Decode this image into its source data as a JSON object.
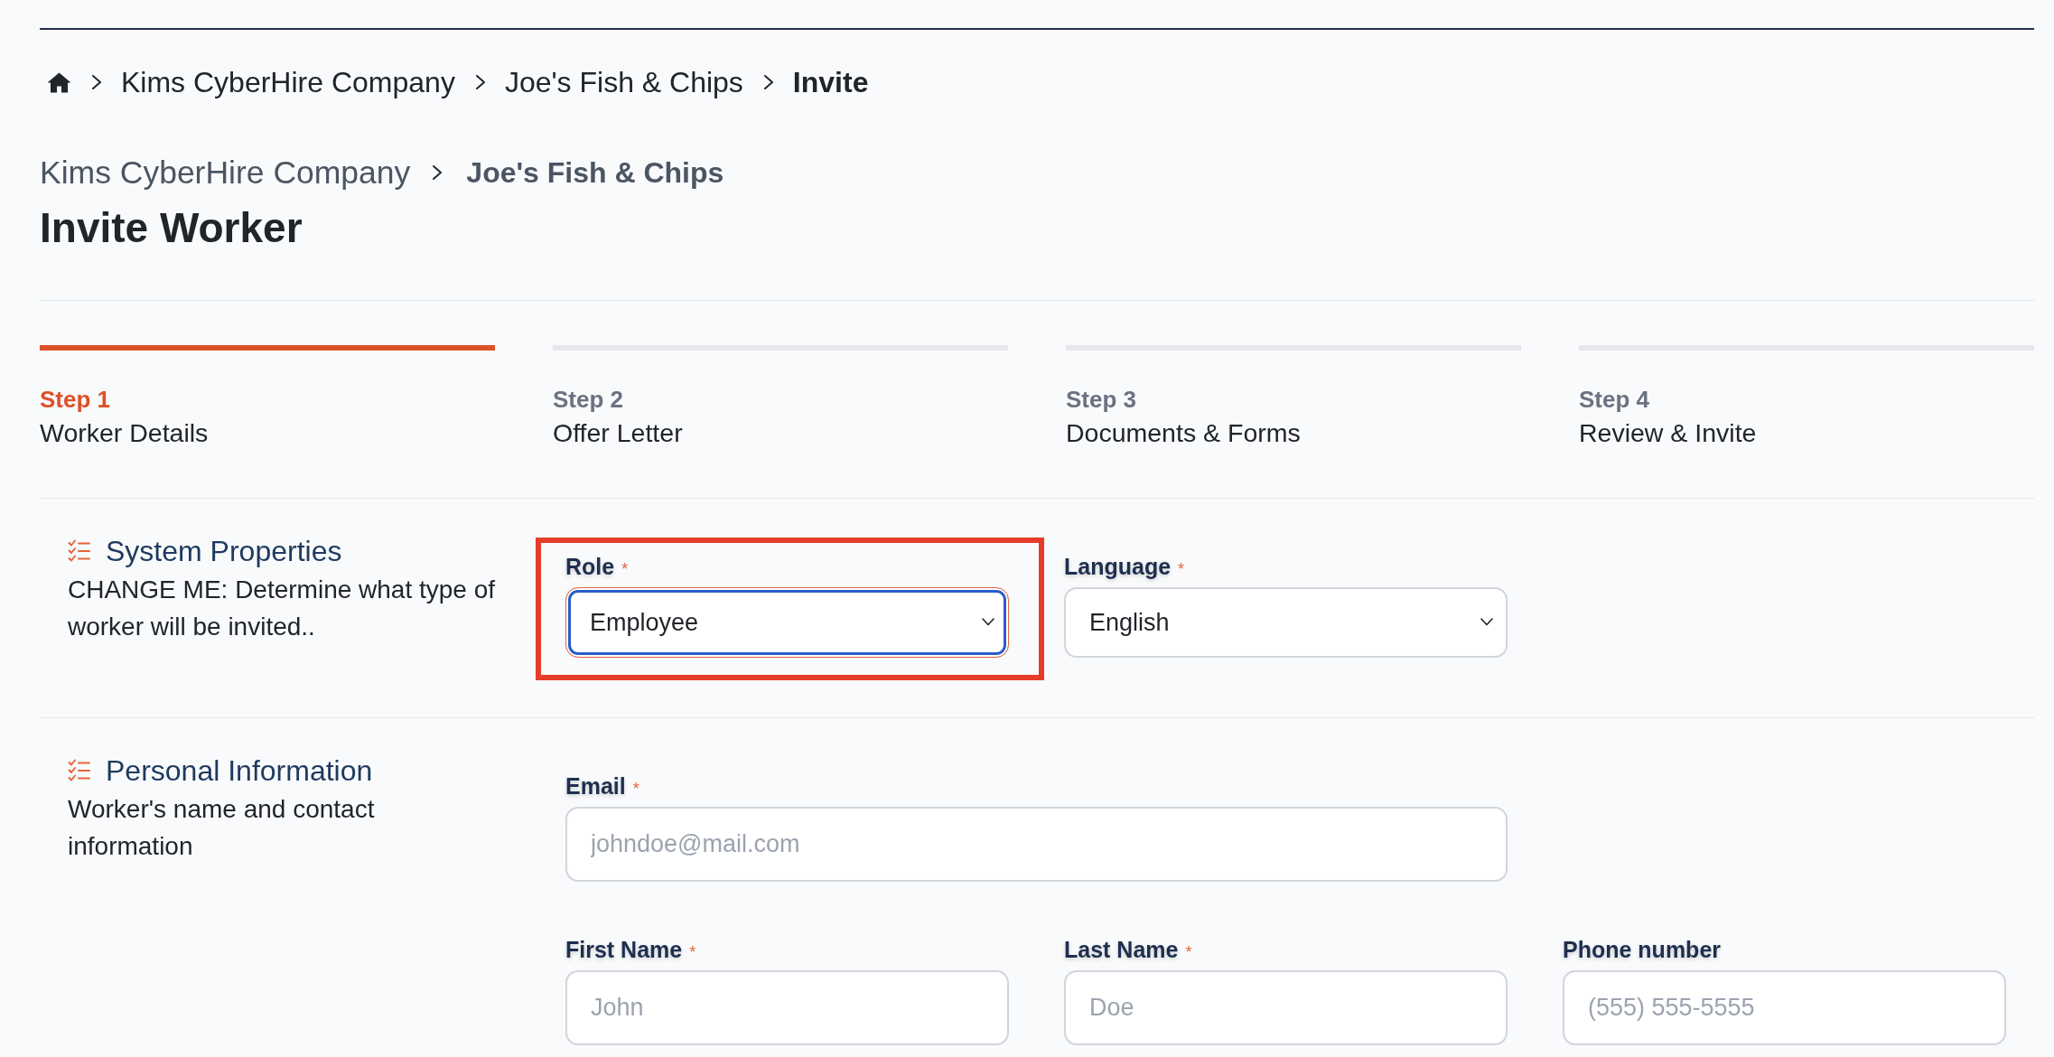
{
  "breadcrumb": {
    "items": [
      {
        "label": "Kims CyberHire Company",
        "current": false
      },
      {
        "label": "Joe's Fish & Chips",
        "current": false
      },
      {
        "label": "Invite",
        "current": true
      }
    ]
  },
  "page_header": {
    "trail": [
      {
        "label": "Kims CyberHire Company",
        "current": false
      },
      {
        "label": "Joe's Fish & Chips",
        "current": true
      }
    ],
    "title": "Invite Worker"
  },
  "steps": [
    {
      "label": "Step 1",
      "title": "Worker Details",
      "selected": true
    },
    {
      "label": "Step 2",
      "title": "Offer Letter",
      "selected": false
    },
    {
      "label": "Step 3",
      "title": "Documents & Forms",
      "selected": false
    },
    {
      "label": "Step 4",
      "title": "Review & Invite",
      "selected": false
    }
  ],
  "sections": [
    {
      "title": "System Properties",
      "description": "CHANGE ME: Determine what type of worker will be invited..",
      "rows": [
        {
          "fields": [
            {
              "kind": "select",
              "label": "Role",
              "required_mark": "*",
              "value": "Employee",
              "wide": false,
              "focused": true,
              "highlighted": true
            },
            {
              "kind": "select",
              "label": "Language",
              "required_mark": "*",
              "value": "English",
              "wide": false,
              "focused": false,
              "highlighted": false
            }
          ]
        }
      ]
    },
    {
      "title": "Personal Information",
      "description": "Worker's name and contact information",
      "rows": [
        {
          "fields": [
            {
              "kind": "text",
              "label": "Email",
              "required_mark": "*",
              "placeholder": "johndoe@mail.com",
              "wide": true,
              "focused": false,
              "highlighted": false
            }
          ]
        },
        {
          "fields": [
            {
              "kind": "text",
              "label": "First Name",
              "required_mark": "*",
              "placeholder": "John",
              "wide": false,
              "focused": false,
              "highlighted": false
            },
            {
              "kind": "text",
              "label": "Last Name",
              "required_mark": "*",
              "placeholder": "Doe",
              "wide": false,
              "focused": false,
              "highlighted": false
            },
            {
              "kind": "text",
              "label": "Phone number",
              "placeholder": "(555) 555-5555",
              "wide": false,
              "focused": false,
              "highlighted": false
            }
          ]
        }
      ]
    }
  ]
}
